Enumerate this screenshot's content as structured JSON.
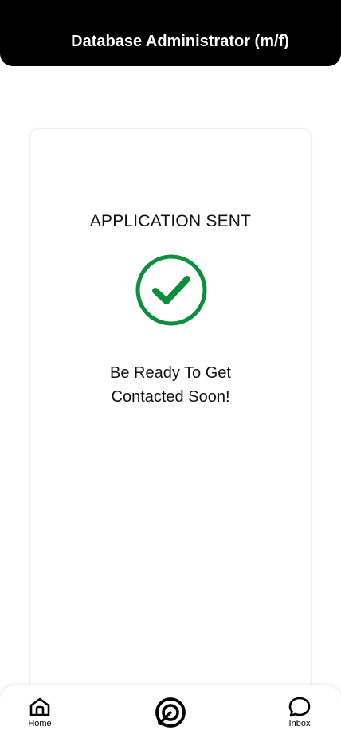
{
  "header": {
    "title": "Database Administrator (m/f)"
  },
  "card": {
    "status_title": "APPLICATION SENT",
    "status_icon": "check-circle-icon",
    "message_line_1": "Be Ready To Get",
    "message_line_2": "Contacted Soon!"
  },
  "bottom_nav": {
    "home_label": "Home",
    "center_icon": "target-icon",
    "inbox_label": "Inbox"
  },
  "colors": {
    "header_background": "#000000",
    "header_text": "#ffffff",
    "success_green": "#0c8f3c"
  }
}
